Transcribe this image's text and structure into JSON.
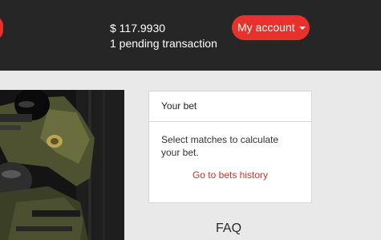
{
  "header": {
    "balance": "$ 117.9930",
    "pending": "1 pending transaction",
    "account_button": "My account"
  },
  "bet_panel": {
    "title": "Your bet",
    "message": "Select matches to calculate your bet.",
    "history_link": "Go to bets history"
  },
  "faq": {
    "title": "FAQ"
  },
  "colors": {
    "topbar": "#262626",
    "accent": "#e8312b",
    "link": "#c0392b",
    "page_bg": "#e9e9e9"
  },
  "icons": {
    "account_caret": "chevron-down-icon"
  }
}
